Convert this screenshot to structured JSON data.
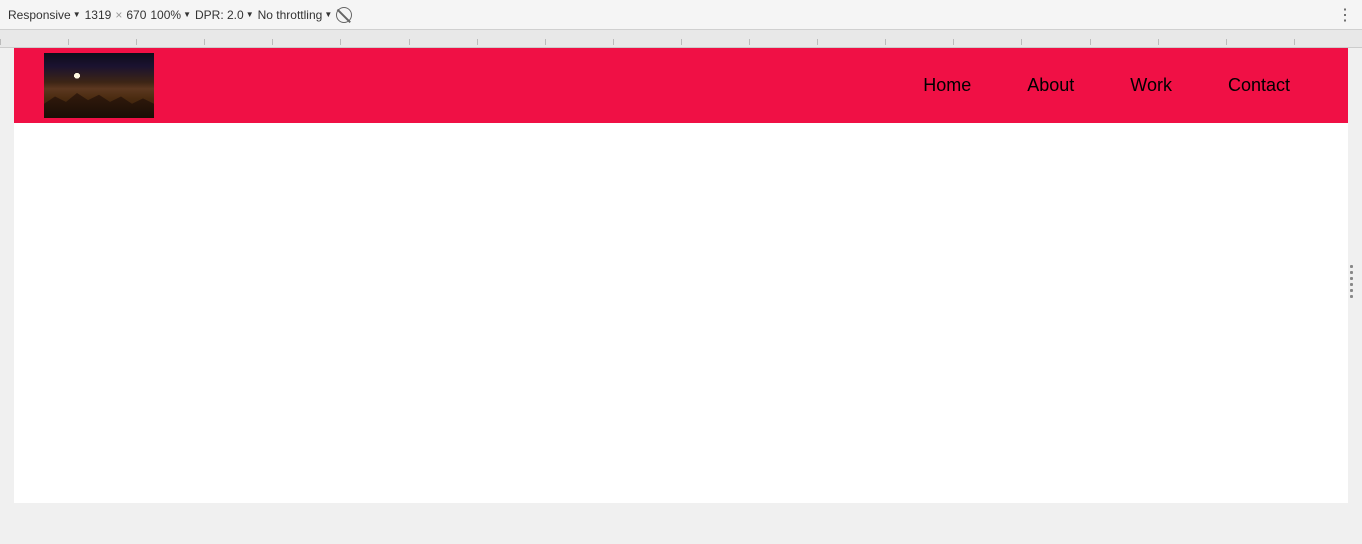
{
  "devtools": {
    "responsive_label": "Responsive",
    "width_value": "1319",
    "separator": "×",
    "height_value": "670",
    "zoom_label": "100%",
    "dpr_label": "DPR: 2.0",
    "throttle_label": "No throttling",
    "more_options_icon": "⋮"
  },
  "navbar": {
    "items": [
      {
        "label": "Home",
        "id": "home"
      },
      {
        "label": "About",
        "id": "about"
      },
      {
        "label": "Work",
        "id": "work"
      },
      {
        "label": "Contact",
        "id": "contact"
      }
    ]
  },
  "colors": {
    "header_bg": "#f01045",
    "nav_text": "#000000",
    "body_bg": "#ffffff"
  }
}
